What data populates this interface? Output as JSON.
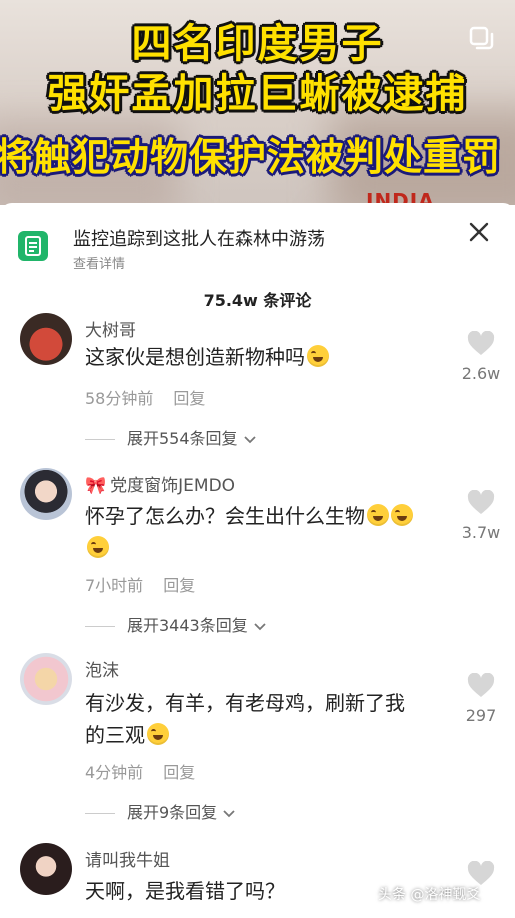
{
  "banner": {
    "caption_line1": "四名印度男子",
    "caption_line2": "强奸孟加拉巨蜥被逮捕",
    "caption_line3": "将触犯动物保护法被判处重罚",
    "corner_tag": "INDIA",
    "copy_icon": "copy-icon"
  },
  "link_card": {
    "icon": "document-icon",
    "title": "监控追踪到这批人在森林中游荡",
    "subtitle": "查看详情",
    "close_icon": "close-icon"
  },
  "comment_count": "75.4w 条评论",
  "comments": [
    {
      "username": "大树哥",
      "text": "这家伙是想创造新物种吗",
      "emoji": "laughing-crying-emoji",
      "time": "58分钟前",
      "reply": "回复",
      "expand": "展开554条回复",
      "likes": "2.6w"
    },
    {
      "username_prefix": "🎀",
      "username": "党度窗饰JEMDO",
      "text": "怀孕了怎么办？会生出什么生物",
      "emoji": "laughing-crying-emoji",
      "time": "7小时前",
      "reply": "回复",
      "expand": "展开3443条回复",
      "likes": "3.7w"
    },
    {
      "username": "泡沫",
      "text_line1": "有沙发，有羊，有老母鸡，刷新了我",
      "text_line2": "的三观",
      "emoji": "laughing-crying-emoji",
      "time": "4分钟前",
      "reply": "回复",
      "expand": "展开9条回复",
      "likes": "297"
    },
    {
      "username": "请叫我牛姐",
      "text": "天啊，是我看错了吗？"
    }
  ],
  "watermark": "头条 @洛神觐爻",
  "colors": {
    "caption_yellow": "#ffe100",
    "caption_stroke": "#111111",
    "caption3_stroke": "#1a1a7a",
    "doc_icon_green": "#21b56a",
    "secondary_text": "#999999"
  }
}
